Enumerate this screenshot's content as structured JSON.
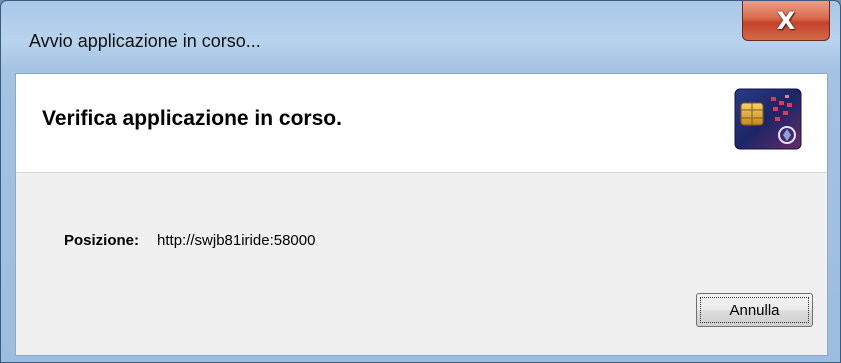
{
  "window": {
    "title": "Avvio applicazione in corso...",
    "close_label": "X"
  },
  "header": {
    "title": "Verifica applicazione in corso.",
    "logo_icon": "java-card-icon"
  },
  "details": {
    "location_label": "Posizione:",
    "location_value": "http://swjb81iride:58000"
  },
  "actions": {
    "cancel_label": "Annulla"
  },
  "colors": {
    "titlebar": "#b8d3ee",
    "close_button": "#c5422a",
    "dialog_body": "#f0f0f0",
    "header_bg": "#ffffff"
  }
}
